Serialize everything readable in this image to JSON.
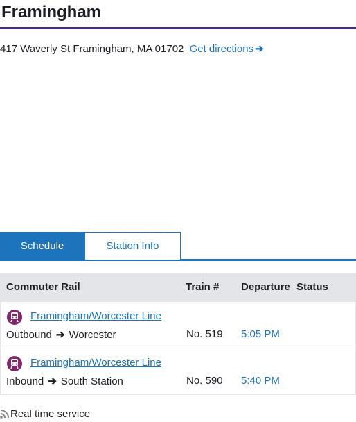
{
  "station": {
    "title": "Framingham",
    "address": "417 Waverly St Framingham, MA 01702",
    "directions_label": "Get directions"
  },
  "tabs": [
    {
      "label": "Schedule",
      "active": true
    },
    {
      "label": "Station Info",
      "active": false
    }
  ],
  "table": {
    "headers": {
      "line": "Commuter Rail",
      "train": "Train #",
      "departure": "Departure",
      "status": "Status"
    },
    "rows": [
      {
        "line": "Framingham/Worcester Line",
        "direction": "Outbound",
        "destination": "Worcester",
        "train": "No. 519",
        "departure": "5:05 PM",
        "status": ""
      },
      {
        "line": "Framingham/Worcester Line",
        "direction": "Inbound",
        "destination": "South Station",
        "train": "No. 590",
        "departure": "5:40 PM",
        "status": ""
      }
    ]
  },
  "footer": {
    "realtime_label": "Real time service"
  },
  "colors": {
    "accent": "#1c75bc",
    "title_rule": "#4c2b90",
    "commuter_rail": "#80276c",
    "header_bg": "#e3e5e8"
  },
  "icons": {
    "directions": "arrow-right-icon",
    "line": "commuter-rail-icon",
    "realtime": "realtime-icon"
  }
}
